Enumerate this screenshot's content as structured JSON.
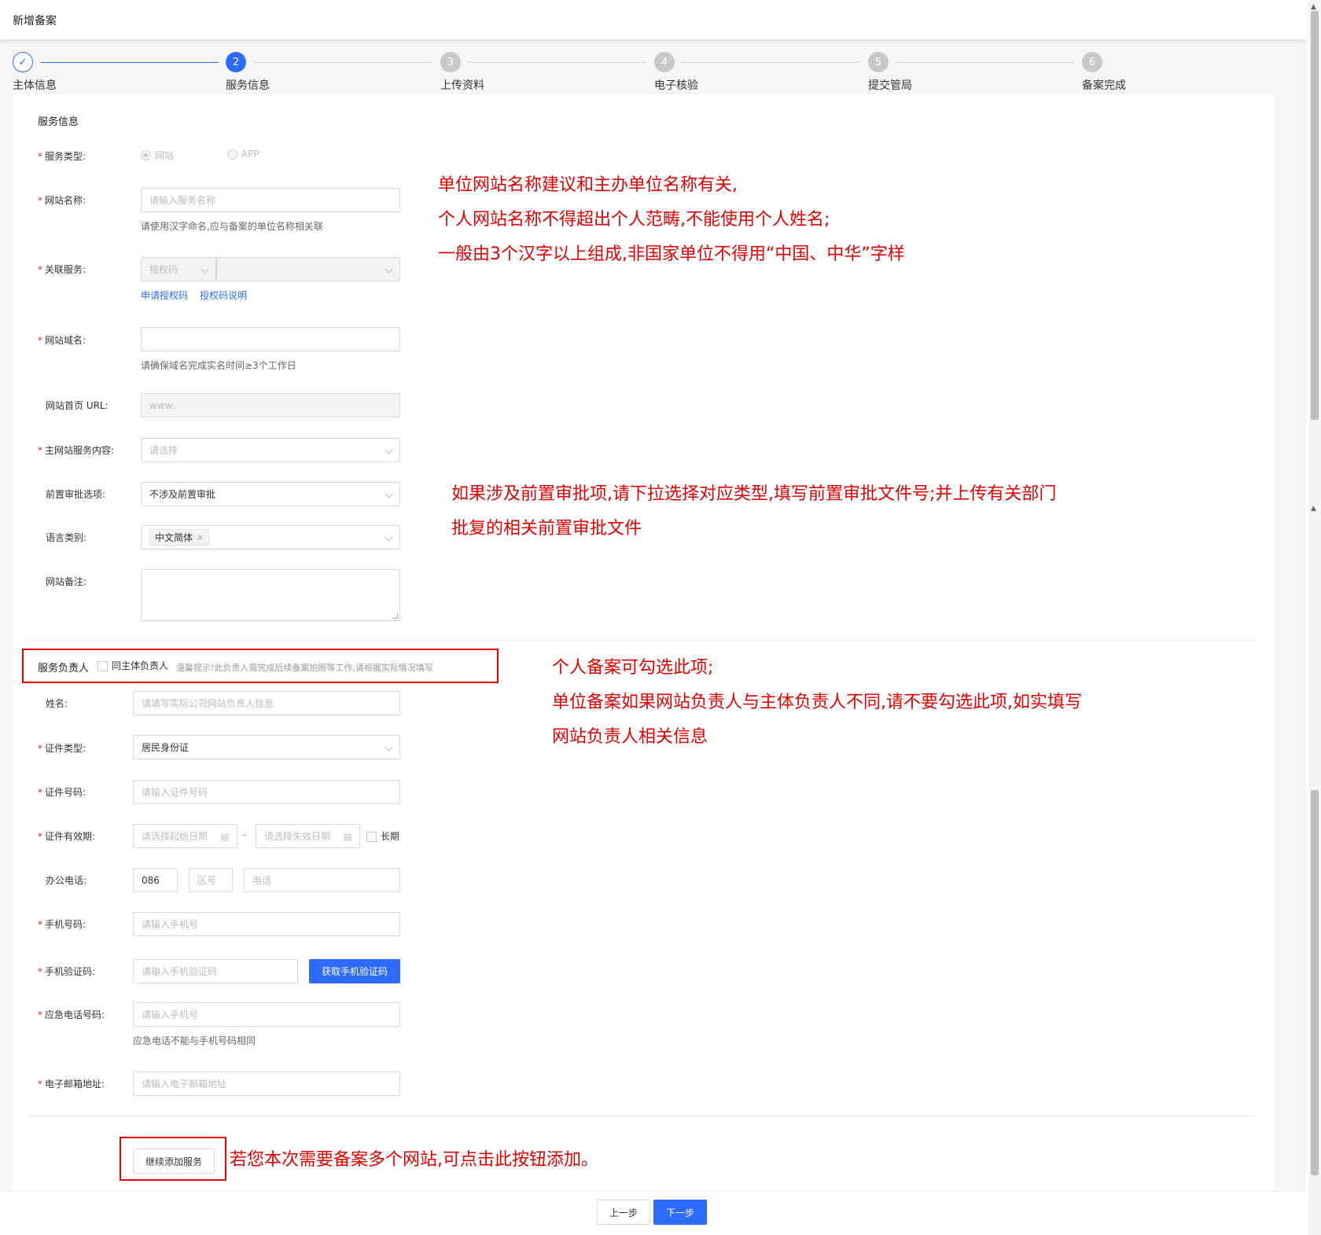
{
  "header": {
    "title": "新增备案"
  },
  "steps": [
    {
      "num": "✓",
      "label": "主体信息",
      "state": "done"
    },
    {
      "num": "2",
      "label": "服务信息",
      "state": "active"
    },
    {
      "num": "3",
      "label": "上传资料",
      "state": "pending"
    },
    {
      "num": "4",
      "label": "电子核验",
      "state": "pending"
    },
    {
      "num": "5",
      "label": "提交管局",
      "state": "pending"
    },
    {
      "num": "6",
      "label": "备案完成",
      "state": "pending"
    }
  ],
  "service": {
    "section_title": "服务信息",
    "service_type": {
      "label": "服务类型:",
      "options": [
        "网站",
        "APP"
      ],
      "selected": "网站"
    },
    "site_name": {
      "label": "网站名称:",
      "placeholder": "请输入服务名称",
      "help": "请使用汉字命名,应与备案的单位名称相关联"
    },
    "related": {
      "label": "关联服务:",
      "select1": "授权码",
      "select2": "",
      "link1": "申请授权码",
      "link2": "授权码说明"
    },
    "domain": {
      "label": "网站域名:",
      "value": "",
      "help": "请确保域名完成实名时间≥3个工作日"
    },
    "homepage": {
      "label": "网站首页 URL:",
      "placeholder": "www."
    },
    "main_content": {
      "label": "主网站服务内容:",
      "placeholder": "请选择"
    },
    "pre_approval": {
      "label": "前置审批选项:",
      "value": "不涉及前置审批"
    },
    "language": {
      "label": "语言类别:",
      "tag": "中文简体",
      "tag_close": "×"
    },
    "remarks": {
      "label": "网站备注:"
    }
  },
  "owner": {
    "section_title": "服务负责人",
    "same_label": "同主体负责人",
    "tip": "温馨提示!此负责人需完成后续备案拍照等工作,请根据实际情况填写",
    "name": {
      "label": "姓名:",
      "placeholder": "请填写实际公司网站负责人信息"
    },
    "id_type": {
      "label": "证件类型:",
      "value": "居民身份证"
    },
    "id_number": {
      "label": "证件号码:",
      "placeholder": "请输入证件号码"
    },
    "id_validity": {
      "label": "证件有效期:",
      "start_placeholder": "请选择起始日期",
      "sep": "–",
      "end_placeholder": "请选择失效日期",
      "long_term": "长期"
    },
    "office_phone": {
      "label": "办公电话:",
      "country": "086",
      "area_placeholder": "区号",
      "phone_placeholder": "电话"
    },
    "mobile": {
      "label": "手机号码:",
      "placeholder": "请输入手机号"
    },
    "sms_code": {
      "label": "手机验证码:",
      "placeholder": "请输入手机验证码",
      "button": "获取手机验证码"
    },
    "emergency": {
      "label": "应急电话号码:",
      "placeholder": "请输入手机号",
      "help": "应急电话不能与手机号码相同"
    },
    "email": {
      "label": "电子邮箱地址:",
      "placeholder": "请输入电子邮箱地址"
    }
  },
  "add_service_button": "继续添加服务",
  "footer": {
    "prev": "上一步",
    "next": "下一步"
  },
  "annotations": {
    "site_name_note": [
      "单位网站名称建议和主办单位名称有关,",
      "个人网站名称不得超出个人范畴,不能使用个人姓名;",
      "一般由3个汉字以上组成,非国家单位不得用“中国、中华”字样"
    ],
    "pre_approval_note": [
      "如果涉及前置审批项,请下拉选择对应类型,填写前置审批文件号;并上传有关部门",
      "批复的相关前置审批文件"
    ],
    "owner_note": [
      "个人备案可勾选此项;",
      "单位备案如果网站负责人与主体负责人不同,请不要勾选此项,如实填写",
      "网站负责人相关信息"
    ],
    "add_note": "若您本次需要备案多个网站,可点击此按钮添加。"
  },
  "colors": {
    "accent": "#2d6bff",
    "annotation": "#e30000",
    "required": "#f5222d"
  }
}
